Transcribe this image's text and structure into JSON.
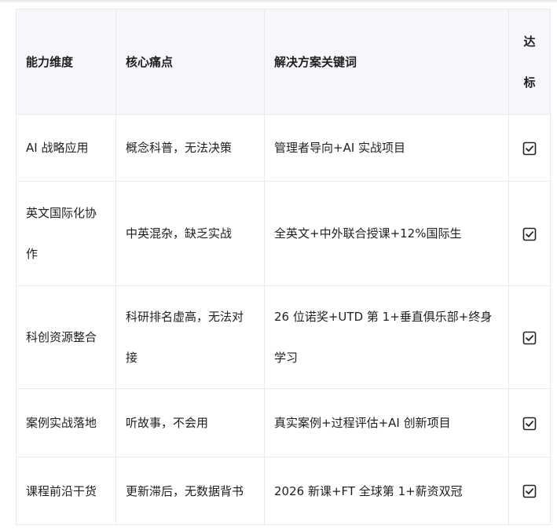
{
  "table": {
    "headers": {
      "dimension": "能力维度",
      "pain_point": "核心痛点",
      "keywords": "解决方案关键词",
      "status": "达标"
    },
    "rows": [
      {
        "dimension": "AI 战略应用",
        "pain_point": "概念科普，无法决策",
        "keywords": "管理者导向+AI 实战项目",
        "status": "checked"
      },
      {
        "dimension": "英文国际化协作",
        "pain_point": "中英混杂，缺乏实战",
        "keywords": "全英文+中外联合授课+12%国际生",
        "status": "checked"
      },
      {
        "dimension": "科创资源整合",
        "pain_point": "科研排名虚高，无法对接",
        "keywords": "26 位诺奖+UTD 第 1+垂直俱乐部+终身学习",
        "status": "checked"
      },
      {
        "dimension": "案例实战落地",
        "pain_point": "听故事，不会用",
        "keywords": "真实案例+过程评估+AI 创新项目",
        "status": "checked"
      },
      {
        "dimension": "课程前沿干货",
        "pain_point": "更新滞后，无数据背书",
        "keywords": "2026 新课+FT 全球第 1+薪资双冠",
        "status": "checked"
      }
    ]
  },
  "icons": {
    "status": "checkbox-checked-icon"
  },
  "colors": {
    "header_bg": "#f5f7fa",
    "border": "#ebebeb",
    "text": "#1f1f1f"
  }
}
